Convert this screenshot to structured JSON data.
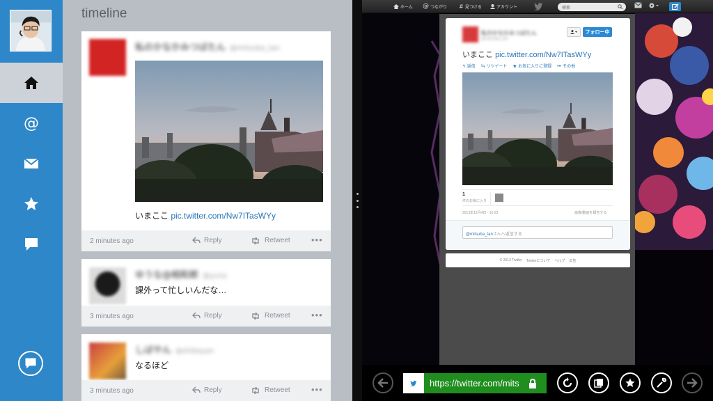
{
  "left_app": {
    "title": "timeline",
    "nav": [
      "home-icon",
      "at-icon",
      "mail-icon",
      "star-icon",
      "chat-icon"
    ],
    "tweets": [
      {
        "name": "私のかなかみつばたん",
        "handle": "@mitsuba_tan",
        "text": "いまここ ",
        "link": "pic.twitter.com/Nw7ITasWYy",
        "time": "2 minutes ago",
        "reply": "Reply",
        "retweet": "Retweet",
        "more": "•••"
      },
      {
        "name": "ゆうな@相和郎",
        "handle": "@yuna",
        "text": "課外って忙しいんだな…",
        "time": "3 minutes ago",
        "reply": "Reply",
        "retweet": "Retweet",
        "more": "•••"
      },
      {
        "name": "しばやん",
        "handle": "@shibayan",
        "text": "なるほど",
        "time": "3 minutes ago",
        "reply": "Reply",
        "retweet": "Retweet",
        "more": "•••"
      }
    ]
  },
  "browser": {
    "topbar": {
      "home": "ホーム",
      "connect": "つながり",
      "discover": "見つける",
      "account": "アカウント",
      "search_placeholder": "検索"
    },
    "permalink": {
      "name": "私のかなかみつばたん",
      "handle": "@mitsuba_tan",
      "follow": "フォロー中",
      "text": "いまここ ",
      "link": "pic.twitter.com/Nw7ITasWYy",
      "actions": [
        "返信",
        "リツイート",
        "お気に入りに登録",
        "その他"
      ],
      "fav_count": "1",
      "fav_label": "件のお気に入り",
      "date": "2013年12月4日 - 16:23",
      "report": "画像/動画を報告する",
      "reply_mention": "@mitsuba_tan",
      "reply_suffix": "さんへ返信する"
    },
    "footer": [
      "© 2013 Twitter",
      "Twitterについて",
      "ヘルプ",
      "広告"
    ],
    "address_url": "https://twitter.com/mits"
  },
  "colors": {
    "nav_blue": "#2e87c8",
    "link_blue": "#2a76b9",
    "address_green": "#1f8e1f",
    "follow_blue": "#2a8ad4"
  }
}
